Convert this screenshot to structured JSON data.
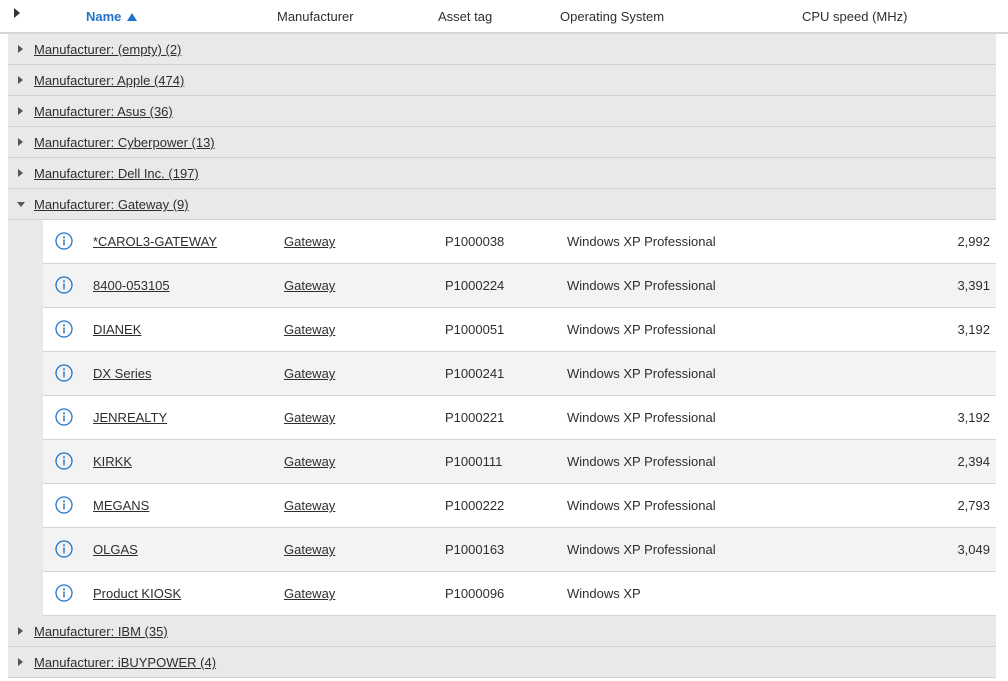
{
  "header": {
    "name": "Name",
    "manufacturer": "Manufacturer",
    "asset_tag": "Asset tag",
    "operating_system": "Operating System",
    "cpu_speed": "CPU speed (MHz)"
  },
  "groups_before": [
    {
      "label": "Manufacturer: (empty) (2)"
    },
    {
      "label": "Manufacturer: Apple (474)"
    },
    {
      "label": "Manufacturer: Asus (36)"
    },
    {
      "label": "Manufacturer: Cyberpower (13)"
    },
    {
      "label": "Manufacturer: Dell Inc. (197)"
    }
  ],
  "expanded_group": {
    "label": "Manufacturer: Gateway (9)",
    "rows": [
      {
        "name": "*CAROL3-GATEWAY",
        "manufacturer": "Gateway",
        "asset_tag": "P1000038",
        "os": "Windows XP Professional",
        "cpu": "2,992"
      },
      {
        "name": "8400-053105",
        "manufacturer": "Gateway",
        "asset_tag": "P1000224",
        "os": "Windows XP Professional",
        "cpu": "3,391"
      },
      {
        "name": "DIANEK",
        "manufacturer": "Gateway",
        "asset_tag": "P1000051",
        "os": "Windows XP Professional",
        "cpu": "3,192"
      },
      {
        "name": "DX Series",
        "manufacturer": "Gateway",
        "asset_tag": "P1000241",
        "os": "Windows XP Professional",
        "cpu": ""
      },
      {
        "name": "JENREALTY",
        "manufacturer": "Gateway",
        "asset_tag": "P1000221",
        "os": "Windows XP Professional",
        "cpu": "3,192"
      },
      {
        "name": "KIRKK",
        "manufacturer": "Gateway",
        "asset_tag": "P1000111",
        "os": "Windows XP Professional",
        "cpu": "2,394"
      },
      {
        "name": "MEGANS",
        "manufacturer": "Gateway",
        "asset_tag": "P1000222",
        "os": "Windows XP Professional",
        "cpu": "2,793"
      },
      {
        "name": "OLGAS",
        "manufacturer": "Gateway",
        "asset_tag": "P1000163",
        "os": "Windows XP Professional",
        "cpu": "3,049"
      },
      {
        "name": "Product KIOSK",
        "manufacturer": "Gateway",
        "asset_tag": "P1000096",
        "os": "Windows XP",
        "cpu": ""
      }
    ]
  },
  "groups_after": [
    {
      "label": "Manufacturer: IBM (35)"
    },
    {
      "label": "Manufacturer: iBUYPOWER (4)"
    }
  ],
  "colors": {
    "accent": "#1f73c9",
    "group_bg": "#e8e9eb",
    "alt_row_bg": "#f3f3f3"
  },
  "icons": {
    "expand_all": "triangle-right-icon",
    "sort": "sort-ascending-icon",
    "collapsed": "chevron-right-icon",
    "expanded": "chevron-down-icon",
    "info": "info-circle-icon"
  }
}
